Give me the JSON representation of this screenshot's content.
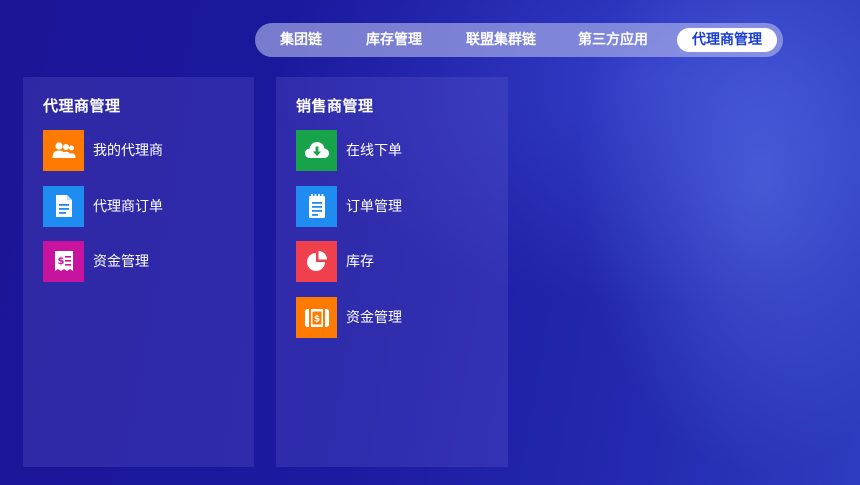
{
  "nav": {
    "tabs": [
      {
        "label": "集团链"
      },
      {
        "label": "库存管理"
      },
      {
        "label": "联盟集群链"
      },
      {
        "label": "第三方应用"
      },
      {
        "label": "代理商管理",
        "active": true
      }
    ]
  },
  "panels": [
    {
      "title": "代理商管理",
      "items": [
        {
          "label": "我的代理商",
          "icon": "users-icon",
          "color": "#ff7a00"
        },
        {
          "label": "代理商订单",
          "icon": "document-icon",
          "color": "#1e8cf0"
        },
        {
          "label": "资金管理",
          "icon": "money-bill-icon",
          "color": "#c8139e"
        }
      ]
    },
    {
      "title": "销售商管理",
      "items": [
        {
          "label": "在线下单",
          "icon": "cloud-download-icon",
          "color": "#16a34a"
        },
        {
          "label": "订单管理",
          "icon": "notepad-icon",
          "color": "#1e8cf0"
        },
        {
          "label": "库存",
          "icon": "pie-chart-icon",
          "color": "#f0404e"
        },
        {
          "label": "资金管理",
          "icon": "wallet-icon",
          "color": "#ff7a00"
        }
      ]
    }
  ]
}
